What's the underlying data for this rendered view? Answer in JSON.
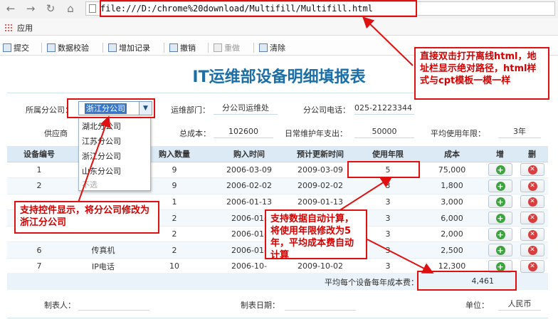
{
  "browser": {
    "address_url": "file:///D:/chrome%20download/Multifill/Multifill.html",
    "bookmark_apps_label": "应用"
  },
  "report_toolbar": {
    "submit": "提交",
    "validate": "数据校验",
    "add_record": "增加记录",
    "undo": "撤销",
    "redo": "重做",
    "clear": "清除"
  },
  "form": {
    "title": "IT运维部设备明细填报表",
    "branch_label": "所属分公司：",
    "branch_value": "浙江分公司",
    "branch_options": [
      "湖北分公司",
      "江苏分公司",
      "浙江分公司",
      "山东分公司",
      "不选"
    ],
    "dept_label": "运维部门：",
    "dept_value": "分公司运维处",
    "phone_label": "分公司电话：",
    "phone_value": "025-21223344",
    "supplier_label": "供应商",
    "total_cost_label": "总成本：",
    "total_cost_value": "102600",
    "maint_label": "日常维护年支出：",
    "maint_value": "50000",
    "avg_life_label": "平均使用年限：",
    "avg_life_value": "3年"
  },
  "table": {
    "headers": [
      "设备编号",
      "",
      "购入数量",
      "购入时间",
      "预计更新时间",
      "使用年限",
      "成本",
      "增",
      "删"
    ],
    "rows": [
      {
        "id": "1",
        "name": "",
        "qty": "9",
        "buy": "2006-03-09",
        "renew": "2009-03-09",
        "years": "5",
        "cost": "75,000"
      },
      {
        "id": "2",
        "name": "",
        "qty": "9",
        "buy": "2006-02-02",
        "renew": "2009-02-02",
        "years": "3",
        "cost": "1,800"
      },
      {
        "id": "",
        "name": "",
        "qty": "1",
        "buy": "2006-01-13",
        "renew": "2009-01-13",
        "years": "3",
        "cost": "3,000"
      },
      {
        "id": "",
        "name": "",
        "qty": "2",
        "buy": "2006-01-",
        "renew": "",
        "years": "3",
        "cost": "6,000"
      },
      {
        "id": "",
        "name": "",
        "qty": "2",
        "buy": "2006-01-",
        "renew": "",
        "years": "3",
        "cost": "2,000"
      },
      {
        "id": "6",
        "name": "传真机",
        "qty": "2",
        "buy": "2006-01-",
        "renew": "",
        "years": "3",
        "cost": "2,500"
      },
      {
        "id": "7",
        "name": "IP电话",
        "qty": "10",
        "buy": "2006-10-",
        "renew": "2009-10-02",
        "years": "3",
        "cost": "12,300"
      }
    ],
    "avg_label": "平均每个设备每年成本费：",
    "avg_value": "4,461"
  },
  "footer": {
    "maker_label": "制表人：",
    "date_label": "制表日期：",
    "unit_label": "单位：",
    "unit_value": "人民币"
  },
  "annotations": {
    "top": "直接双击打开离线html，地址栏显示绝对路径，html样式与cpt模板一模一样",
    "left": "支持控件显示，将分公司修改为浙江分公司",
    "middle": "支持数据自动计算，将使用年限修改为5年，平均成本费自动计算"
  },
  "colors": {
    "title": "#1a6fa8",
    "annotation_red": "#e01010",
    "header_bg": "#dbeaf5"
  }
}
